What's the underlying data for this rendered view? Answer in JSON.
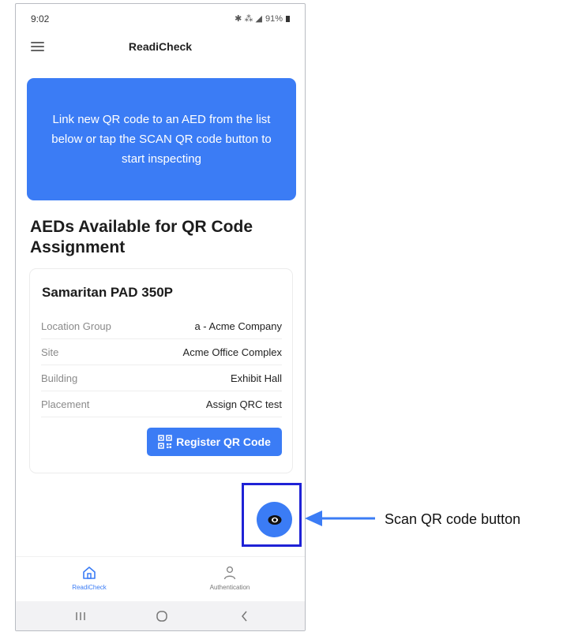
{
  "status_bar": {
    "time": "9:02",
    "signal_icons": "✱ ⁂ ◢",
    "battery": "91%"
  },
  "app_bar": {
    "title": "ReadiCheck"
  },
  "banner": {
    "text": "Link new QR code to an AED from the list below or tap the SCAN QR code button to start inspecting"
  },
  "section": {
    "heading": "AEDs Available for QR Code Assignment"
  },
  "aed": {
    "name": "Samaritan PAD 350P",
    "details": [
      {
        "label": "Location Group",
        "value": "a - Acme Company"
      },
      {
        "label": "Site",
        "value": "Acme Office Complex"
      },
      {
        "label": "Building",
        "value": "Exhibit Hall"
      },
      {
        "label": "Placement",
        "value": "Assign QRC test"
      }
    ],
    "register_label": "Register QR Code"
  },
  "bottom_nav": [
    {
      "label": "ReadiCheck",
      "icon": "home-icon",
      "active": true
    },
    {
      "label": "Authentication",
      "icon": "person-icon",
      "active": false
    }
  ],
  "annotation": {
    "label": "Scan QR code button"
  },
  "colors": {
    "accent": "#3b7cf5",
    "highlight": "#1f22d6"
  }
}
